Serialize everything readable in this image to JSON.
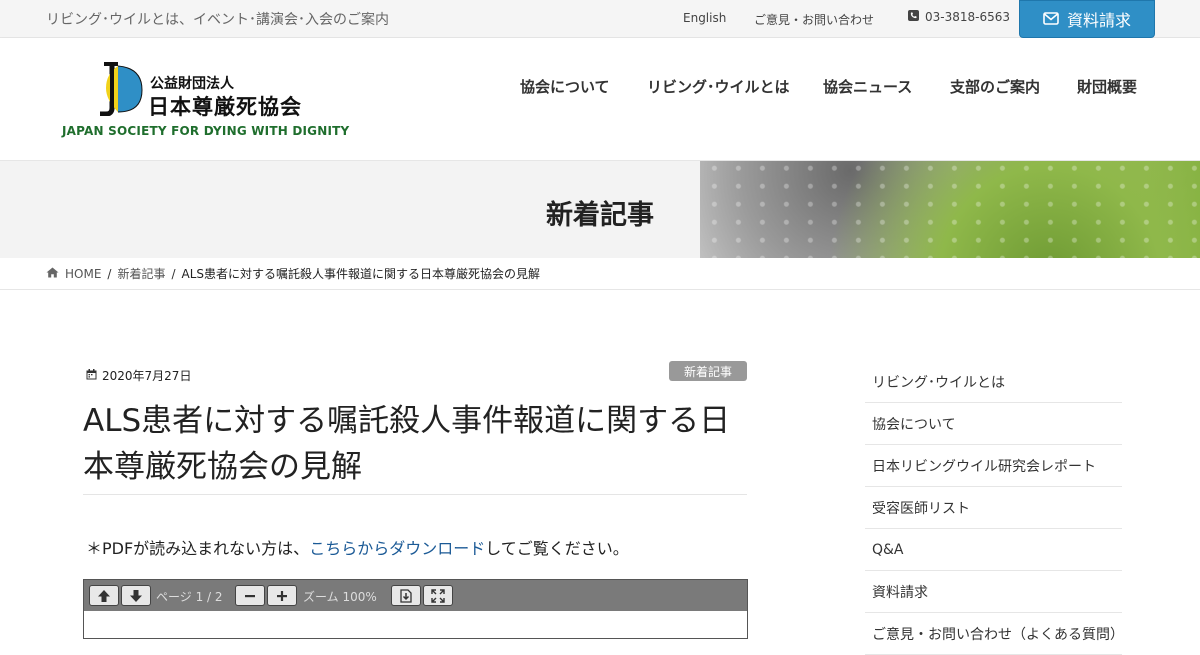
{
  "topbar": {
    "tagline": "リビング･ウイルとは、イベント･講演会･入会のご案内",
    "english": "English",
    "contact": "ご意見・お問い合わせ",
    "phone": "03-3818-6563",
    "request_button": "資料請求"
  },
  "logo": {
    "sub": "公益財団法人",
    "name": "日本尊厳死協会",
    "en": "JAPAN SOCIETY FOR DYING WITH DIGNITY"
  },
  "nav": {
    "items": [
      "協会について",
      "リビング･ウイルとは",
      "協会ニュース",
      "支部のご案内",
      "財団概要"
    ]
  },
  "hero": {
    "title": "新着記事"
  },
  "breadcrumb": {
    "home": "HOME",
    "category": "新着記事",
    "current": "ALS患者に対する嘱託殺人事件報道に関する日本尊厳死協会の見解"
  },
  "article": {
    "date": "2020年7月27日",
    "category": "新着記事",
    "title": "ALS患者に対する嘱託殺人事件報道に関する日本尊厳死協会の見解",
    "note_prefix": "＊PDFが読み込まれない方は、",
    "note_link": "こちらからダウンロード",
    "note_suffix": "してご覧ください。"
  },
  "pdf_viewer": {
    "page_label": "ページ 1 / 2",
    "zoom_label": "ズーム 100%"
  },
  "sidebar": {
    "items": [
      "リビング･ウイルとは",
      "協会について",
      "日本リビングウイル研究会レポート",
      "受容医師リスト",
      "Q&A",
      "資料請求",
      "ご意見・お問い合わせ（よくある質問）"
    ]
  },
  "colors": {
    "accent": "#2f8fc6",
    "logo_green": "#1f6e2d",
    "link": "#1b5a96"
  }
}
